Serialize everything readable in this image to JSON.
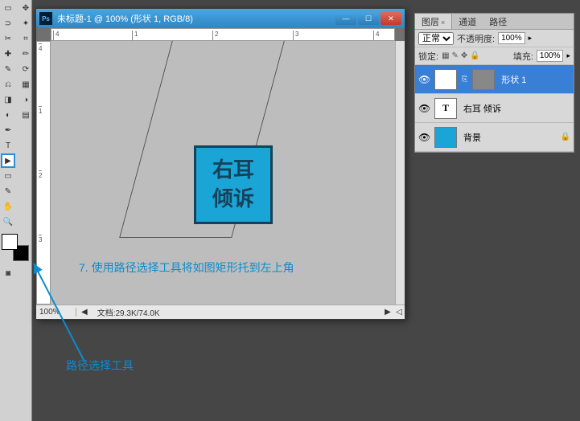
{
  "document": {
    "title": "未标题-1 @ 100% (形状 1, RGB/8)",
    "zoom": "100%",
    "docsize": "文档:29.3K/74.0K",
    "ruler_h": [
      "4",
      "",
      "",
      "1",
      "",
      "",
      "2",
      "",
      "",
      "3",
      "",
      "",
      "4"
    ],
    "ruler_v": [
      "4",
      "",
      "1",
      "",
      "2",
      "",
      "3"
    ]
  },
  "bluebox": {
    "line1": "右耳",
    "line2": "倾诉"
  },
  "annotation": {
    "step": "7. 使用路径选择工具将如图矩形托到左上角",
    "tool_label": "路径选择工具"
  },
  "panels": {
    "tabs": {
      "layers": "图层",
      "channels": "通道",
      "paths": "路径"
    },
    "blend_mode": "正常",
    "opacity_label": "不透明度:",
    "opacity_value": "100%",
    "lock_label": "锁定:",
    "fill_label": "填充:",
    "fill_value": "100%",
    "layers": [
      {
        "name": "形状 1"
      },
      {
        "name": "右耳 倾诉"
      },
      {
        "name": "背景"
      }
    ]
  },
  "winbuttons": {
    "min": "—",
    "max": "☐",
    "close": "✕"
  },
  "tools": [
    "▭",
    "⊡",
    "✥",
    "✂",
    "✎",
    "⌨",
    "⟋",
    "◧",
    "⬚",
    "◐",
    "T",
    "▶",
    "▭",
    "✿",
    "✋",
    "🔍",
    "⋯"
  ]
}
